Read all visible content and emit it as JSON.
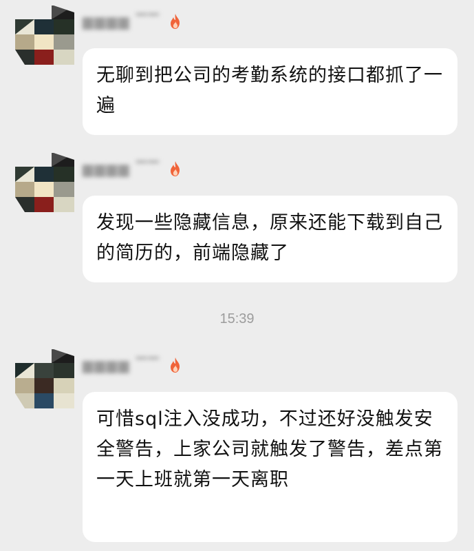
{
  "chat": {
    "timestamp": "15:39",
    "messages": [
      {
        "sender_name": "▆▆▆▆ ▔▔",
        "sender_badge": "fire-icon",
        "text": "无聊到把公司的考勤系统的接口都抓了一遍"
      },
      {
        "sender_name": "▆▆▆▆ ▔▔",
        "sender_badge": "fire-icon",
        "text": "发现一些隐藏信息，原来还能下载到自己的简历的，前端隐藏了"
      },
      {
        "sender_name": "▆▆▆▆ ▔▔",
        "sender_badge": "fire-icon",
        "text": "可惜sql注入没成功，不过还好没触发安全警告，上家公司就触发了警告，差点第一天上班就第一天离职"
      }
    ]
  },
  "colors": {
    "background": "#ededed",
    "bubble": "#ffffff",
    "text": "#111111",
    "timestamp": "#9c9c9c"
  }
}
